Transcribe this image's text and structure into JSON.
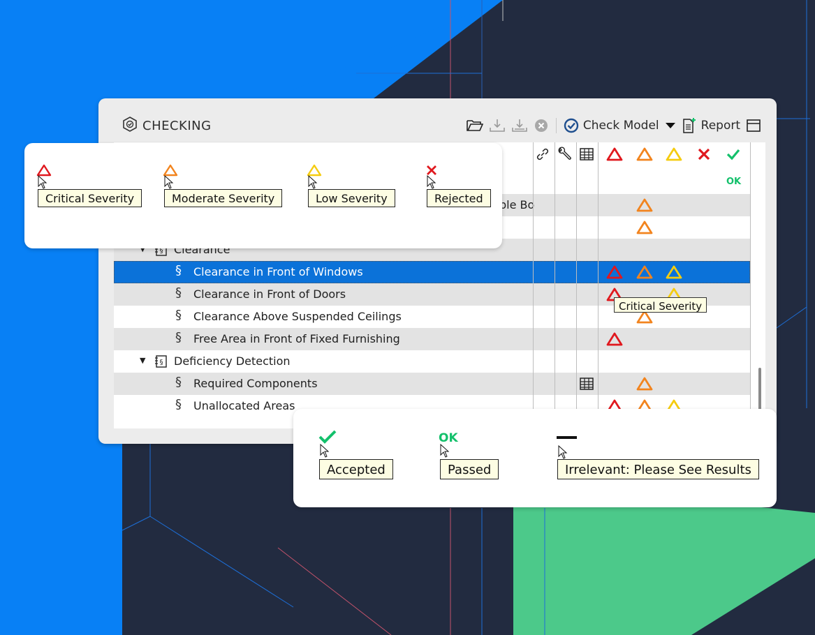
{
  "panel": {
    "title": "CHECKING",
    "toolbar": {
      "check_model_label": "Check Model",
      "report_label": "Report"
    }
  },
  "colors": {
    "critical": "#e0181e",
    "moderate": "#f2841e",
    "low": "#f5cc10",
    "rejected": "#e0181e",
    "accepted": "#13c06b",
    "selection": "#0b72d9"
  },
  "tree": {
    "rows": [
      {
        "label": "",
        "level": "partial-top",
        "ok": "OK"
      },
      {
        "label": "ble Bo"
      },
      {
        "label": ""
      },
      {
        "label": "Clearance",
        "type": "folder"
      },
      {
        "label": "Clearance in Front of Windows",
        "type": "rule",
        "selected": true
      },
      {
        "label": "Clearance in Front of Doors",
        "type": "rule"
      },
      {
        "label": "Clearance Above Suspended Ceilings",
        "type": "rule"
      },
      {
        "label": "Free Area in Front of Fixed Furnishing",
        "type": "rule"
      },
      {
        "label": "Deficiency Detection",
        "type": "folder"
      },
      {
        "label": "Required Components",
        "type": "rule"
      },
      {
        "label": "Unallocated Areas",
        "type": "rule"
      }
    ],
    "tooltip": "Critical Severity"
  },
  "legend_top": [
    {
      "icon": "critical-triangle-icon",
      "label": "Critical Severity"
    },
    {
      "icon": "moderate-triangle-icon",
      "label": "Moderate Severity"
    },
    {
      "icon": "low-triangle-icon",
      "label": "Low Severity"
    },
    {
      "icon": "rejected-x-icon",
      "label": "Rejected"
    }
  ],
  "legend_bottom": [
    {
      "icon": "accepted-check-icon",
      "label": "Accepted"
    },
    {
      "icon": "ok-icon",
      "label": "Passed",
      "glyph": "OK"
    },
    {
      "icon": "dash-icon",
      "label": "Irrelevant: Please See Results"
    }
  ]
}
